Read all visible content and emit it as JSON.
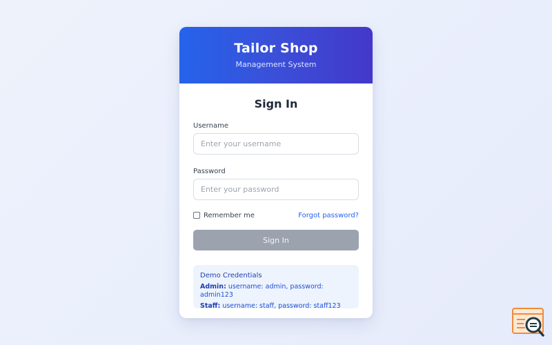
{
  "header": {
    "title": "Tailor Shop",
    "subtitle": "Management System"
  },
  "form": {
    "heading": "Sign In",
    "username_label": "Username",
    "username_placeholder": "Enter your username",
    "password_label": "Password",
    "password_placeholder": "Enter your password",
    "remember_label": "Remember me",
    "remember_checked": false,
    "forgot_label": "Forgot password?",
    "submit_label": "Sign In"
  },
  "demo": {
    "title": "Demo Credentials",
    "admin_key": "Admin:",
    "admin_value": "username: admin, password: admin123",
    "staff_key": "Staff:",
    "staff_value": "username: staff, password: staff123"
  },
  "colors": {
    "header_gradient_start": "#2563eb",
    "header_gradient_end": "#4338ca",
    "button_disabled": "#9ca3af",
    "link": "#2563eb",
    "demo_background": "#eef4fd"
  },
  "icons": {
    "corner_badge": "search-document-icon"
  }
}
